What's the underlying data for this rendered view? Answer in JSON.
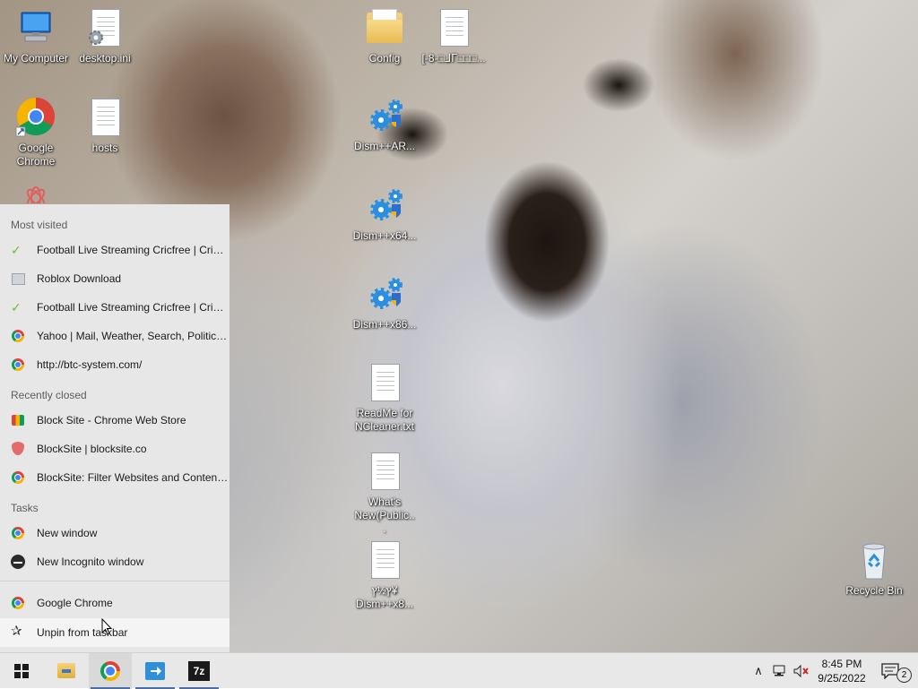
{
  "desktop": {
    "icons": [
      {
        "label": "My Computer"
      },
      {
        "label": "desktop.ini"
      },
      {
        "label": "Google Chrome"
      },
      {
        "label": "hosts"
      },
      {
        "label": "Config"
      },
      {
        "label": "[-8-□ᒧᒥ□□□..."
      },
      {
        "label": "Dism++AR..."
      },
      {
        "label": "Dism++x64..."
      },
      {
        "label": "Dism++x86..."
      },
      {
        "label": "ReadMe for NCleaner.txt"
      },
      {
        "label": "What's New(Public..."
      },
      {
        "label": "ץ½ץ¥ Dism++x8..."
      },
      {
        "label": "Recycle Bin"
      }
    ]
  },
  "jumplist": {
    "most_visited_header": "Most visited",
    "most_visited": [
      "Football Live Streaming Cricfree | Cricfr...",
      "Roblox Download",
      "Football Live Streaming Cricfree | Cricfr...",
      "Yahoo | Mail, Weather, Search, Politics,...",
      "http://btc-system.com/"
    ],
    "recently_closed_header": "Recently closed",
    "recently_closed": [
      "Block Site - Chrome Web Store",
      "BlockSite | blocksite.co",
      "BlockSite: Filter Websites and Content..."
    ],
    "tasks_header": "Tasks",
    "tasks": [
      "New window",
      "New Incognito window"
    ],
    "app_name": "Google Chrome",
    "unpin_label": "Unpin from taskbar"
  },
  "taskbar": {
    "zip_label": "7z",
    "clock_time": "8:45 PM",
    "clock_date": "9/25/2022",
    "notification_count": "2",
    "tray_chevron": "∧"
  }
}
